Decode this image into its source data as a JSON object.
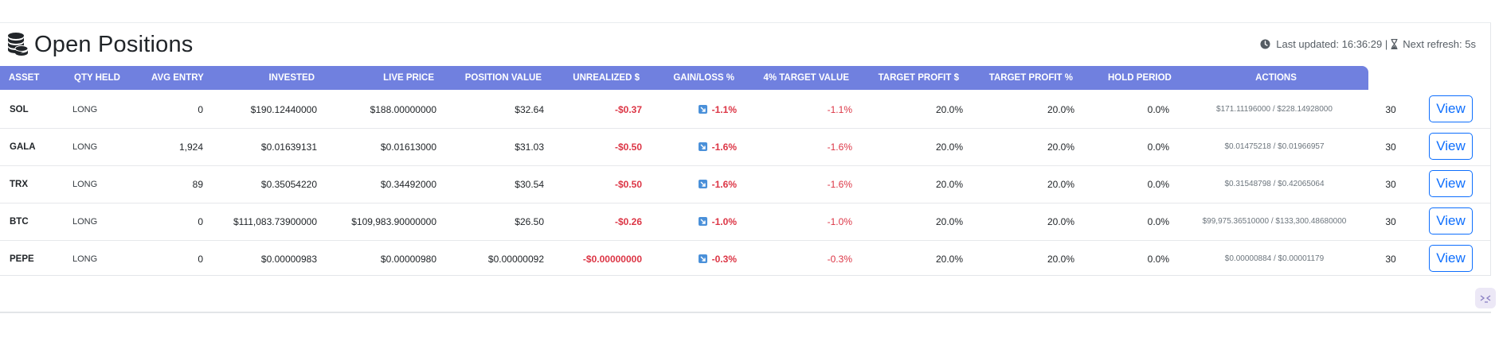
{
  "header": {
    "title": "Open Positions",
    "last_updated_label": "Last updated: 16:36:29 |",
    "next_refresh_label": "Next refresh: 5s"
  },
  "table": {
    "columns": [
      "ASSET",
      "QTY HELD",
      "AVG ENTRY",
      "INVESTED",
      "LIVE PRICE",
      "POSITION VALUE",
      "UNREALIZED $",
      "GAIN/LOSS %",
      "4% TARGET VALUE",
      "TARGET PROFIT $",
      "TARGET PROFIT %",
      "HOLD PERIOD",
      "ACTIONS"
    ],
    "rows": [
      {
        "asset": "SOL",
        "side": "LONG",
        "qty": "0",
        "entry": "$190.12440000",
        "live": "$188.00000000",
        "value": "$32.64",
        "unrealized": "-$0.37",
        "gain": "-1.1%",
        "target_pct": "-1.1%",
        "c10": "20.0%",
        "c11": "20.0%",
        "c12": "0.0%",
        "range": "$171.11196000 / $228.14928000",
        "hold": "30",
        "action": "View"
      },
      {
        "asset": "GALA",
        "side": "LONG",
        "qty": "1,924",
        "entry": "$0.01639131",
        "live": "$0.01613000",
        "value": "$31.03",
        "unrealized": "-$0.50",
        "gain": "-1.6%",
        "target_pct": "-1.6%",
        "c10": "20.0%",
        "c11": "20.0%",
        "c12": "0.0%",
        "range": "$0.01475218 / $0.01966957",
        "hold": "30",
        "action": "View"
      },
      {
        "asset": "TRX",
        "side": "LONG",
        "qty": "89",
        "entry": "$0.35054220",
        "live": "$0.34492000",
        "value": "$30.54",
        "unrealized": "-$0.50",
        "gain": "-1.6%",
        "target_pct": "-1.6%",
        "c10": "20.0%",
        "c11": "20.0%",
        "c12": "0.0%",
        "range": "$0.31548798 / $0.42065064",
        "hold": "30",
        "action": "View"
      },
      {
        "asset": "BTC",
        "side": "LONG",
        "qty": "0",
        "entry": "$111,083.73900000",
        "live": "$109,983.90000000",
        "value": "$26.50",
        "unrealized": "-$0.26",
        "gain": "-1.0%",
        "target_pct": "-1.0%",
        "c10": "20.0%",
        "c11": "20.0%",
        "c12": "0.0%",
        "range": "$99,975.36510000 / $133,300.48680000",
        "hold": "30",
        "action": "View"
      },
      {
        "asset": "PEPE",
        "side": "LONG",
        "qty": "0",
        "entry": "$0.00000983",
        "live": "$0.00000980",
        "value": "$0.00000092",
        "unrealized": "-$0.00000000",
        "gain": "-0.3%",
        "target_pct": "-0.3%",
        "c10": "20.0%",
        "c11": "20.0%",
        "c12": "0.0%",
        "range": "$0.00000884 / $0.00001179",
        "hold": "30",
        "action": "View"
      }
    ]
  },
  "icons": {
    "title": "coins-stack-icon",
    "last_updated": "clock-icon",
    "next_refresh": "hourglass-icon",
    "trend": "arrow-down-right-icon",
    "fab": "console-toggle-icon"
  },
  "colors": {
    "header_bg": "#7080df",
    "negative": "#dc3545",
    "button": "#0d6efd",
    "trend_badge": "#4a90d9"
  }
}
